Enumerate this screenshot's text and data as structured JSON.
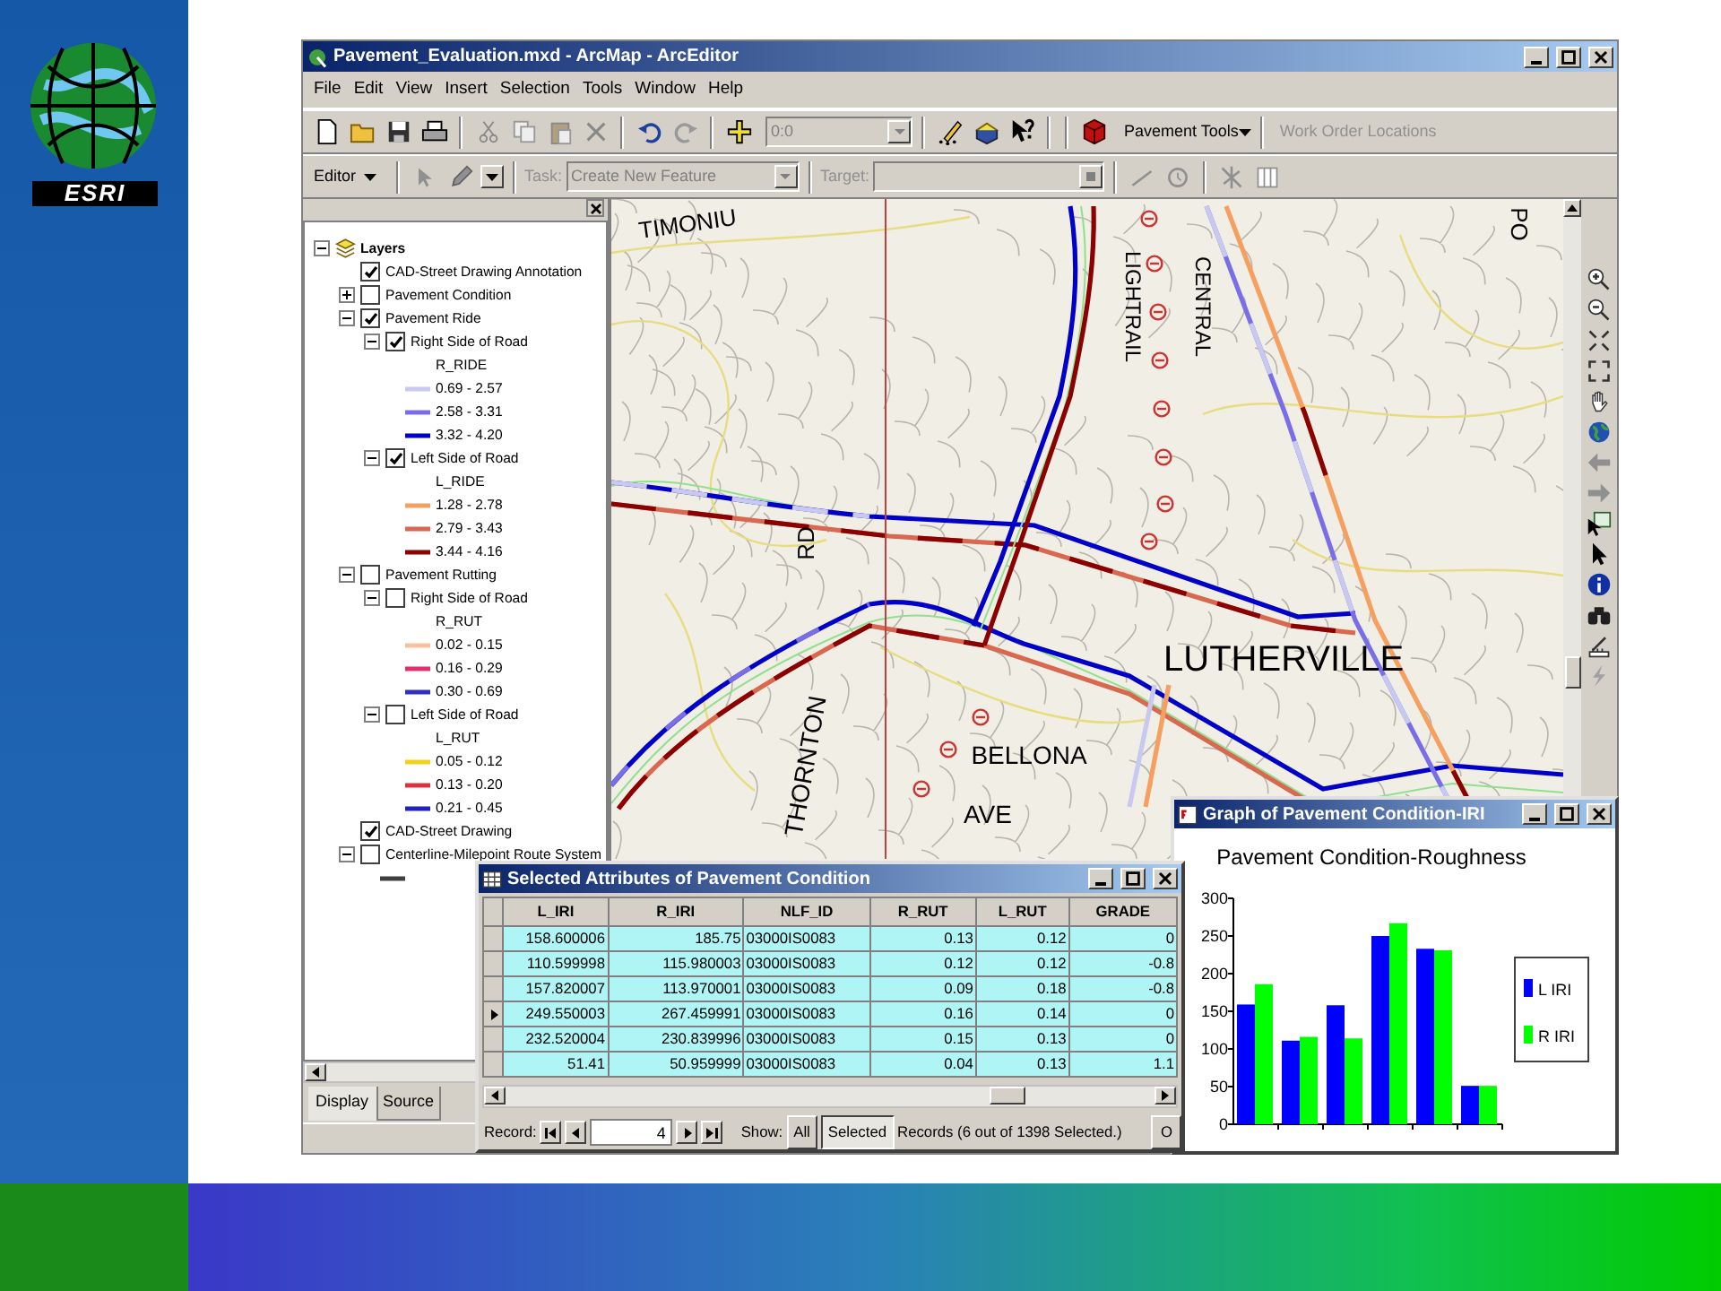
{
  "logo": {
    "text": "ESRI"
  },
  "window": {
    "title": "Pavement_Evaluation.mxd - ArcMap - ArcEditor"
  },
  "menu": [
    "File",
    "Edit",
    "View",
    "Insert",
    "Selection",
    "Tools",
    "Window",
    "Help"
  ],
  "toolbar": {
    "scale_value": "0:0",
    "pavement_tools": "Pavement Tools",
    "work_order": "Work Order Locations"
  },
  "editor_toolbar": {
    "editor": "Editor",
    "task_label": "Task:",
    "task_value": "Create New Feature",
    "target_label": "Target:"
  },
  "toc": {
    "tree": [
      {
        "kind": "group",
        "label": "Layers",
        "expanded": true,
        "children": [
          {
            "kind": "layer",
            "label": "CAD-Street Drawing Annotation",
            "checked": true
          },
          {
            "kind": "layer",
            "label": "Pavement Condition",
            "checked": false,
            "expanded": false
          },
          {
            "kind": "layer",
            "label": "Pavement Ride",
            "checked": true,
            "expanded": true,
            "children": [
              {
                "kind": "layer",
                "label": "Right Side of Road",
                "checked": true,
                "expanded": true,
                "children": [
                  {
                    "kind": "field",
                    "label": "R_RIDE"
                  },
                  {
                    "kind": "class",
                    "label": "0.69 - 2.57",
                    "color": "#c8c8f0"
                  },
                  {
                    "kind": "class",
                    "label": "2.58 - 3.31",
                    "color": "#7a6ee6"
                  },
                  {
                    "kind": "class",
                    "label": "3.32 - 4.20",
                    "color": "#0000c8"
                  }
                ]
              },
              {
                "kind": "layer",
                "label": "Left Side of Road",
                "checked": true,
                "expanded": true,
                "children": [
                  {
                    "kind": "field",
                    "label": "L_RIDE"
                  },
                  {
                    "kind": "class",
                    "label": "1.28 - 2.78",
                    "color": "#f5a060"
                  },
                  {
                    "kind": "class",
                    "label": "2.79 - 3.43",
                    "color": "#d86850"
                  },
                  {
                    "kind": "class",
                    "label": "3.44 - 4.16",
                    "color": "#8b0000"
                  }
                ]
              }
            ]
          },
          {
            "kind": "layer",
            "label": "Pavement Rutting",
            "checked": false,
            "expanded": true,
            "children": [
              {
                "kind": "layer",
                "label": "Right Side of Road",
                "checked": false,
                "expanded": true,
                "children": [
                  {
                    "kind": "field",
                    "label": "R_RUT"
                  },
                  {
                    "kind": "class",
                    "label": "0.02 - 0.15",
                    "color": "#f8c0a0"
                  },
                  {
                    "kind": "class",
                    "label": "0.16 - 0.29",
                    "color": "#e0306a"
                  },
                  {
                    "kind": "class",
                    "label": "0.30 - 0.69",
                    "color": "#3030c0"
                  }
                ]
              },
              {
                "kind": "layer",
                "label": "Left Side of Road",
                "checked": false,
                "expanded": true,
                "children": [
                  {
                    "kind": "field",
                    "label": "L_RUT"
                  },
                  {
                    "kind": "class",
                    "label": "0.05 - 0.12",
                    "color": "#f0d020"
                  },
                  {
                    "kind": "class",
                    "label": "0.13 - 0.20",
                    "color": "#e03040"
                  },
                  {
                    "kind": "class",
                    "label": "0.21 - 0.45",
                    "color": "#2020c0"
                  }
                ]
              }
            ]
          },
          {
            "kind": "layer",
            "label": "CAD-Street Drawing",
            "checked": true
          },
          {
            "kind": "layer",
            "label": "Centerline-Milepoint Route System",
            "checked": false,
            "expanded": true,
            "children": [
              {
                "kind": "class",
                "color": "#404040"
              }
            ]
          }
        ]
      }
    ],
    "tabs": [
      {
        "label": "Display",
        "selected": true
      },
      {
        "label": "Source",
        "selected": false
      }
    ]
  },
  "map": {
    "labels": [
      "TIMONIU",
      "CENTRAL",
      "LIGHTRAIL",
      "RD",
      "THORNTON",
      "BELLONA",
      "AVE",
      "LUTHERVILLE",
      "PO"
    ]
  },
  "attributes": {
    "title": "Selected Attributes of Pavement Condition",
    "columns": [
      "L_IRI",
      "R_IRI",
      "NLF_ID",
      "R_RUT",
      "L_RUT",
      "GRADE"
    ],
    "rows": [
      {
        "current": false,
        "cells": [
          "158.600006",
          "185.75",
          "03000IS0083",
          "0.13",
          "0.12",
          "0"
        ]
      },
      {
        "current": false,
        "cells": [
          "110.599998",
          "115.980003",
          "03000IS0083",
          "0.12",
          "0.12",
          "-0.8"
        ]
      },
      {
        "current": false,
        "cells": [
          "157.820007",
          "113.970001",
          "03000IS0083",
          "0.09",
          "0.18",
          "-0.8"
        ]
      },
      {
        "current": true,
        "cells": [
          "249.550003",
          "267.459991",
          "03000IS0083",
          "0.16",
          "0.14",
          "0"
        ]
      },
      {
        "current": false,
        "cells": [
          "232.520004",
          "230.839996",
          "03000IS0083",
          "0.15",
          "0.13",
          "0"
        ]
      },
      {
        "current": false,
        "cells": [
          "51.41",
          "50.959999",
          "03000IS0083",
          "0.04",
          "0.13",
          "1.1"
        ]
      }
    ],
    "record_label": "Record:",
    "record_value": "4",
    "show_label": "Show:",
    "show_buttons": [
      {
        "label": "All",
        "selected": false
      },
      {
        "label": "Selected",
        "selected": true
      }
    ],
    "records_text": "Records (6 out of 1398 Selected.)",
    "options_button": "O"
  },
  "graph": {
    "title": "Graph of Pavement Condition-IRI",
    "chart_data": {
      "type": "bar",
      "title": "Pavement Condition-Roughness",
      "series": [
        {
          "name": "L IRI",
          "color": "#0000ff",
          "values": [
            159,
            111,
            158,
            250,
            233,
            51
          ]
        },
        {
          "name": "R IRI",
          "color": "#00ff00",
          "values": [
            186,
            116,
            114,
            267,
            231,
            51
          ]
        }
      ],
      "legend": "right",
      "ylim": [
        0,
        300
      ],
      "yticks": [
        0,
        50,
        100,
        150,
        200,
        250,
        300
      ]
    }
  }
}
